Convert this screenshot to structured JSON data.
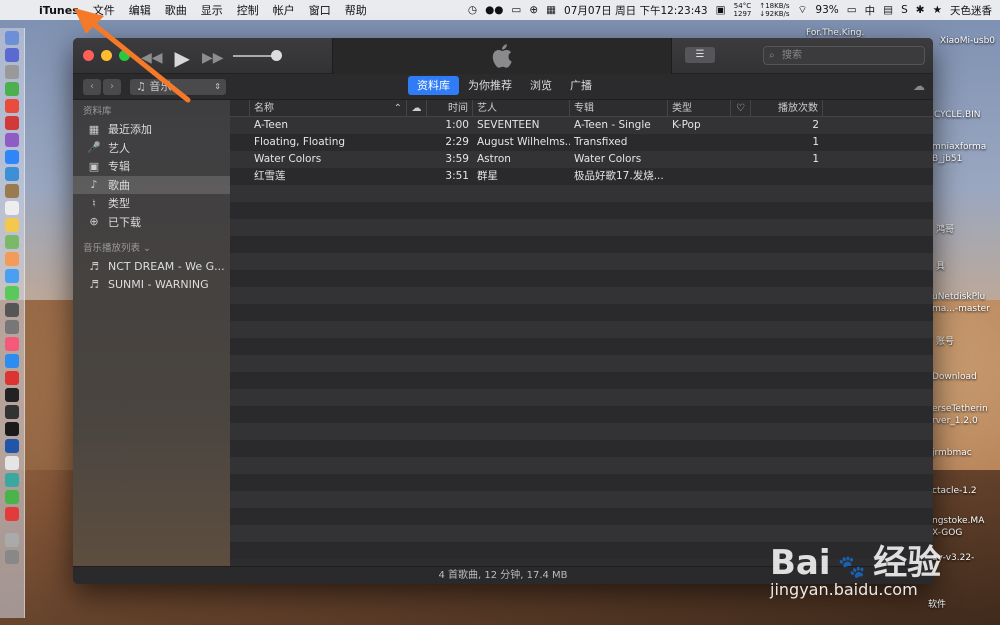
{
  "menubar": {
    "app_name": "iTunes",
    "items": [
      "文件",
      "编辑",
      "歌曲",
      "显示",
      "控制",
      "帐户",
      "窗口",
      "帮助"
    ],
    "temp": "54°C",
    "fan": "1297",
    "up": "↑18KB/s",
    "down": "↓92KB/s",
    "datetime": "07月07日 周日 下午12:23:43",
    "battery": "93%",
    "input_method": "中",
    "user": "天色迷香"
  },
  "desktop": {
    "labels": [
      "For.The.King.",
      "XiaoMi-usb0",
      "CYCLE.BIN",
      "mniaxforma",
      "B_jb51",
      "uNetdiskPlu",
      "ma...-master",
      "Download",
      "erseTetherin",
      "rver_1.2.0",
      "jrmbmac",
      "ctacle-1.2",
      "ngstoke.MA",
      "X-GOG",
      "ay-v3.22-",
      "软件",
      "鸿哥",
      "具",
      "账号"
    ]
  },
  "toolbar": {
    "search_placeholder": "搜索",
    "media_kind": "音乐",
    "back": "‹",
    "forward": "›"
  },
  "tabs": [
    {
      "label": "资料库",
      "active": true
    },
    {
      "label": "为你推荐",
      "active": false
    },
    {
      "label": "浏览",
      "active": false
    },
    {
      "label": "广播",
      "active": false
    }
  ],
  "sidebar": {
    "library_header": "资料库",
    "library_items": [
      {
        "label": "最近添加",
        "icon": "recently-added-icon",
        "selected": false
      },
      {
        "label": "艺人",
        "icon": "artist-icon",
        "selected": false
      },
      {
        "label": "专辑",
        "icon": "album-icon",
        "selected": false
      },
      {
        "label": "歌曲",
        "icon": "song-icon",
        "selected": true
      },
      {
        "label": "类型",
        "icon": "genre-icon",
        "selected": false
      },
      {
        "label": "已下载",
        "icon": "downloaded-icon",
        "selected": false
      }
    ],
    "playlists_header": "音乐播放列表",
    "playlists": [
      {
        "label": "NCT DREAM - We G..."
      },
      {
        "label": "SUNMI - WARNING"
      }
    ]
  },
  "table": {
    "columns": {
      "name": "名称",
      "time": "时间",
      "artist": "艺人",
      "album": "专辑",
      "genre": "类型",
      "plays": "播放次数"
    },
    "rows": [
      {
        "name": "A-Teen",
        "time": "1:00",
        "artist": "SEVENTEEN",
        "album": "A-Teen - Single",
        "genre": "K-Pop",
        "plays": "2"
      },
      {
        "name": "Floating, Floating",
        "time": "2:29",
        "artist": "August Wilhelms...",
        "album": "Transfixed",
        "genre": "",
        "plays": "1"
      },
      {
        "name": "Water Colors",
        "time": "3:59",
        "artist": "Astron",
        "album": "Water Colors",
        "genre": "",
        "plays": "1"
      },
      {
        "name": "红雪莲",
        "time": "3:51",
        "artist": "群星",
        "album": "极品好歌17.发烧...",
        "genre": "",
        "plays": ""
      }
    ]
  },
  "status": "4 首歌曲, 12 分钟, 17.4 MB",
  "watermark": {
    "brand": "Bai",
    "brand2": "经验",
    "url": "jingyan.baidu.com"
  },
  "colors": {
    "accent": "#2f7cf6",
    "arrow": "#f47a2a"
  }
}
